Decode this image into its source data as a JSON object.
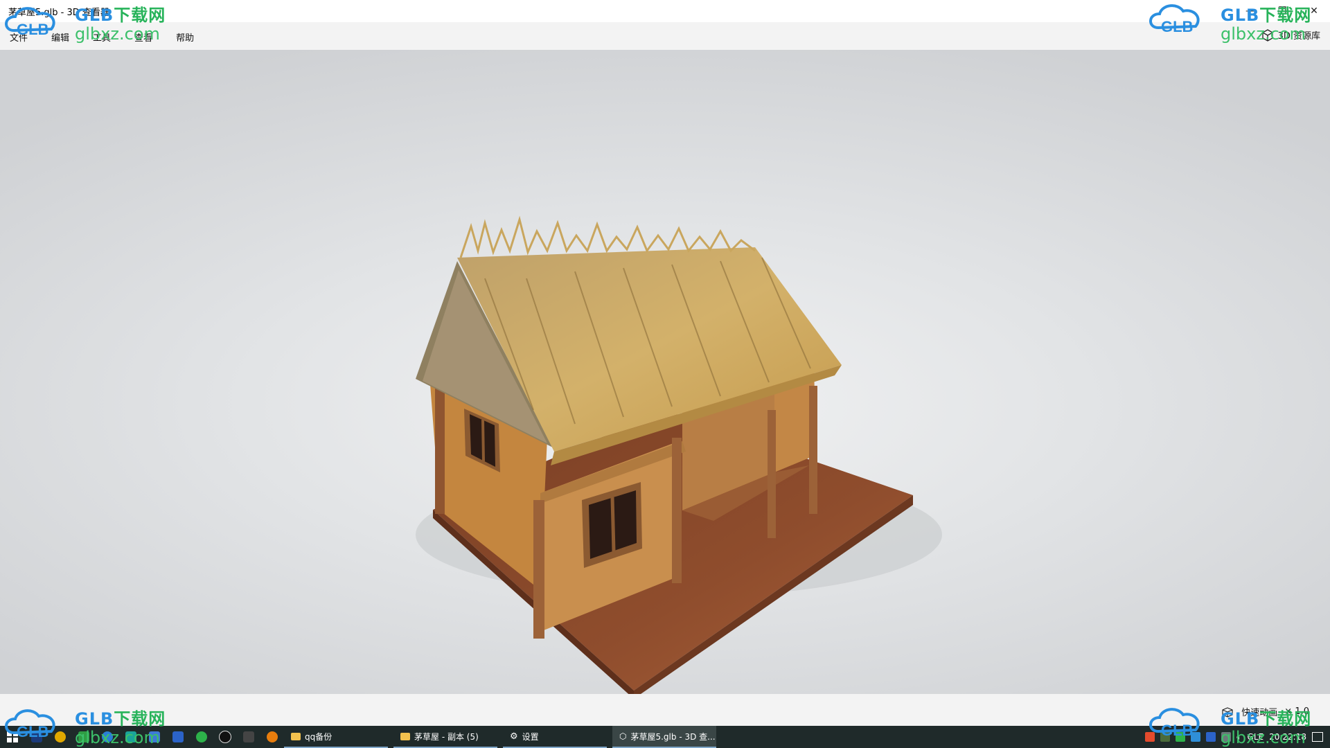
{
  "window": {
    "title": "茅草屋5.glb - 3D 查看器",
    "minimize": "—",
    "maximize": "❐",
    "close": "✕"
  },
  "menu": {
    "items": [
      "文件",
      "编辑",
      "工具",
      "查看",
      "帮助"
    ],
    "library_label": "3D 资源库"
  },
  "statusbar": {
    "animation_label": "快速动画",
    "speed": "× 1.0"
  },
  "taskbar": {
    "tasks": [
      {
        "label": "qq备份",
        "icon": "folder-icon"
      },
      {
        "label": "茅草屋 - 副本 (5)",
        "icon": "folder-icon"
      },
      {
        "label": "设置",
        "icon": "gear-icon"
      },
      {
        "label": "茅草屋5.glb - 3D 查...",
        "icon": "cube-icon"
      }
    ],
    "tray_lang": "GLE",
    "clock": "20:22:18"
  },
  "watermark": {
    "brand": "GLB",
    "cn": "下载网",
    "domain": "glbxz.com",
    "logo_text": "GLB"
  },
  "colors": {
    "thatch": "#c9a65e",
    "wall": "#c98f4e",
    "floor": "#8a4a2c",
    "trim": "#9c6238",
    "taskbar": "#1f2a2a"
  }
}
